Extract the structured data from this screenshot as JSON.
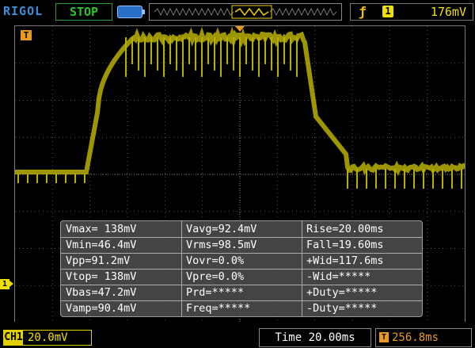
{
  "header": {
    "brand": "RIGOL",
    "run_state": "STOP",
    "trigger_edge_icon": "rising-edge-icon",
    "trigger_source": "1",
    "trigger_level": "176mV"
  },
  "markers": {
    "trigger_marker": "T",
    "channel_marker": "1"
  },
  "measurements": [
    [
      "Vmax= 138mV",
      "Vavg=92.4mV",
      "Rise=20.00ms"
    ],
    [
      "Vmin=46.4mV",
      "Vrms=98.5mV",
      "Fall=19.60ms"
    ],
    [
      "Vpp=91.2mV",
      "Vovr=0.0%",
      "+Wid=117.6ms"
    ],
    [
      "Vtop= 138mV",
      "Vpre=0.0%",
      "-Wid=*****"
    ],
    [
      "Vbas=47.2mV",
      "Prd=*****",
      "+Duty=*****"
    ],
    [
      "Vamp=90.4mV",
      "Freq=*****",
      "-Duty=*****"
    ]
  ],
  "footer": {
    "channel_tag": "CH1",
    "channel_scale": "20.0mV",
    "timebase": "Time 20.00ms",
    "trigger_offset_tag": "T",
    "trigger_offset": "256.8ms"
  },
  "colors": {
    "trace": "#b8b000",
    "brand": "#3a8fd8",
    "stop": "#29c429",
    "trigger": "#e89a20"
  }
}
